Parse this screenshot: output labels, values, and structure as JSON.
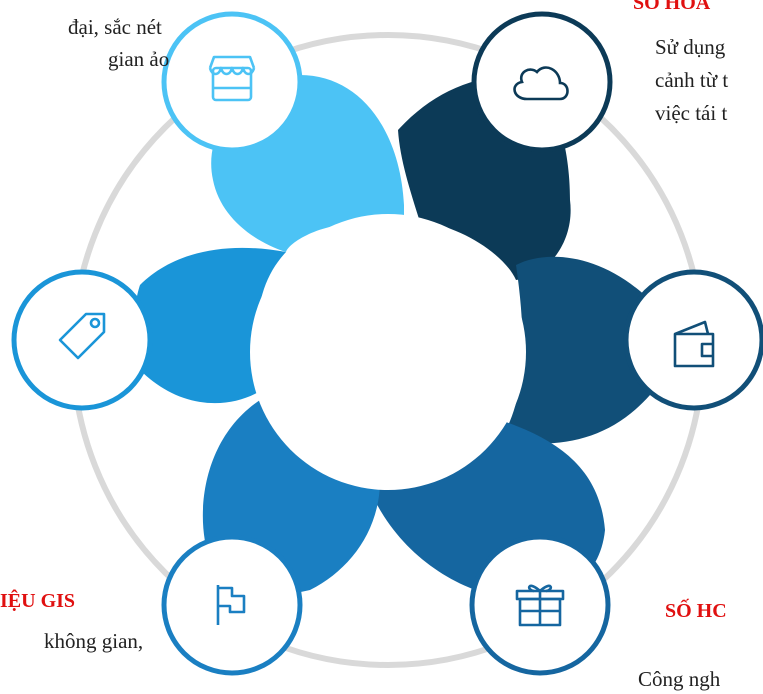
{
  "colors": {
    "ring": "#d9d9d9",
    "petal_top_left": "#4cc3f5",
    "petal_top_right": "#0c3a57",
    "petal_right": "#114f78",
    "petal_bottom_right": "#1566a0",
    "petal_bottom_left": "#1a7fc2",
    "petal_left": "#1a95d8",
    "center": "#ffffff",
    "heading_red": "#e01010"
  },
  "nodes": [
    {
      "id": "top-left",
      "icon": "store-icon",
      "color": "#4cc3f5"
    },
    {
      "id": "top-right",
      "icon": "cloud-icon",
      "color": "#0c3a57"
    },
    {
      "id": "right",
      "icon": "wallet-icon",
      "color": "#114f78"
    },
    {
      "id": "bottom-right",
      "icon": "gift-icon",
      "color": "#1566a0"
    },
    {
      "id": "bottom-left",
      "icon": "flag-icon",
      "color": "#1a7fc2"
    },
    {
      "id": "left",
      "icon": "tag-icon",
      "color": "#1a95d8"
    }
  ],
  "texts": {
    "top_left_line1": "đại, sắc nét",
    "top_left_line2": "gian ảo",
    "top_right_heading": "SỐ HÓA",
    "top_right_line1": "Sử dụng",
    "top_right_line2": "cảnh từ t",
    "top_right_line3": "việc tái t",
    "bottom_left_heading": "IỆU GIS",
    "bottom_left_line1": "không gian,",
    "bottom_right_heading": "SỐ HC",
    "bottom_right_line1": "Công ngh"
  }
}
